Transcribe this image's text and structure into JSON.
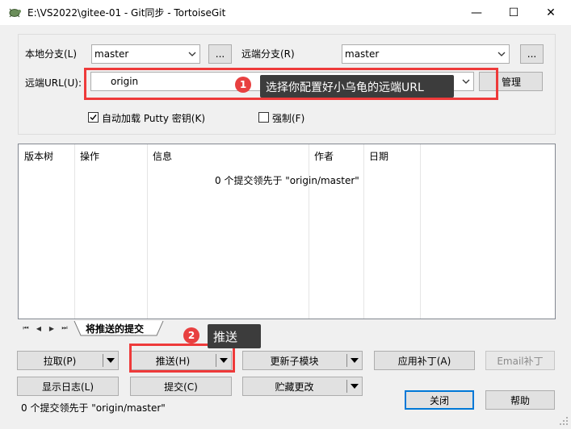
{
  "window": {
    "title": "E:\\VS2022\\gitee-01 - Git同步 - TortoiseGit",
    "minimize": "—",
    "maximize": "☐",
    "close": "✕"
  },
  "sync": {
    "local_branch_label": "本地分支(L)",
    "local_branch_value": "master",
    "local_browse": "...",
    "remote_branch_label": "远端分支(R)",
    "remote_branch_value": "master",
    "remote_browse": "...",
    "remote_url_label": "远端URL(U):",
    "remote_url_value": "origin",
    "manage_label": "管理",
    "autoload_putty_label": "自动加载 Putty 密钥(K)",
    "autoload_putty_checked": true,
    "force_label": "强制(F)",
    "force_checked": false
  },
  "list": {
    "columns": [
      "版本树",
      "操作",
      "信息",
      "作者",
      "日期"
    ],
    "rows": [
      {
        "version_tree": "",
        "action": "",
        "message": "0 个提交领先于 \"origin/master\"",
        "author": "",
        "date": ""
      }
    ]
  },
  "tabs": {
    "active": "将推送的提交"
  },
  "buttons": {
    "pull": "拉取(P)",
    "push": "推送(H)",
    "update_submodules": "更新子模块",
    "apply_patch": "应用补丁(A)",
    "email_patch": "Email补丁",
    "show_log": "显示日志(L)",
    "commit": "提交(C)",
    "stash": "贮藏更改",
    "close": "关闭",
    "help": "帮助"
  },
  "status": {
    "text": "0 个提交领先于 \"origin/master\""
  },
  "annotations": {
    "callout1_number": "1",
    "callout1_text": "选择你配置好小乌龟的远端URL",
    "callout2_number": "2",
    "callout2_text": "推送",
    "highlight_color": "#ee3a3a"
  }
}
